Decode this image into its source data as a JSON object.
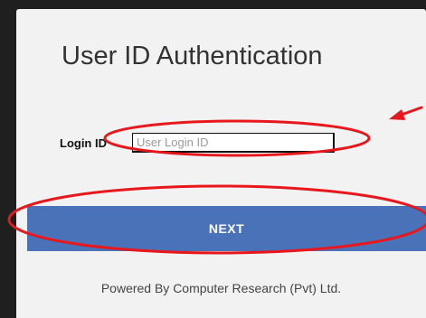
{
  "form": {
    "title": "User ID Authentication",
    "login_label": "Login ID",
    "login_placeholder": "User Login ID",
    "login_value": "",
    "next_label": "NEXT",
    "footer": "Powered By Computer Research (Pvt) Ltd."
  },
  "annotations": {
    "highlight_color": "#e8171b",
    "items": [
      "login-field-highlight",
      "next-button-highlight",
      "pointer-arrow"
    ]
  },
  "colors": {
    "background": "#1f1f1f",
    "card": "#f2f2f2",
    "button": "#4a72b8",
    "button_text": "#ffffff"
  }
}
